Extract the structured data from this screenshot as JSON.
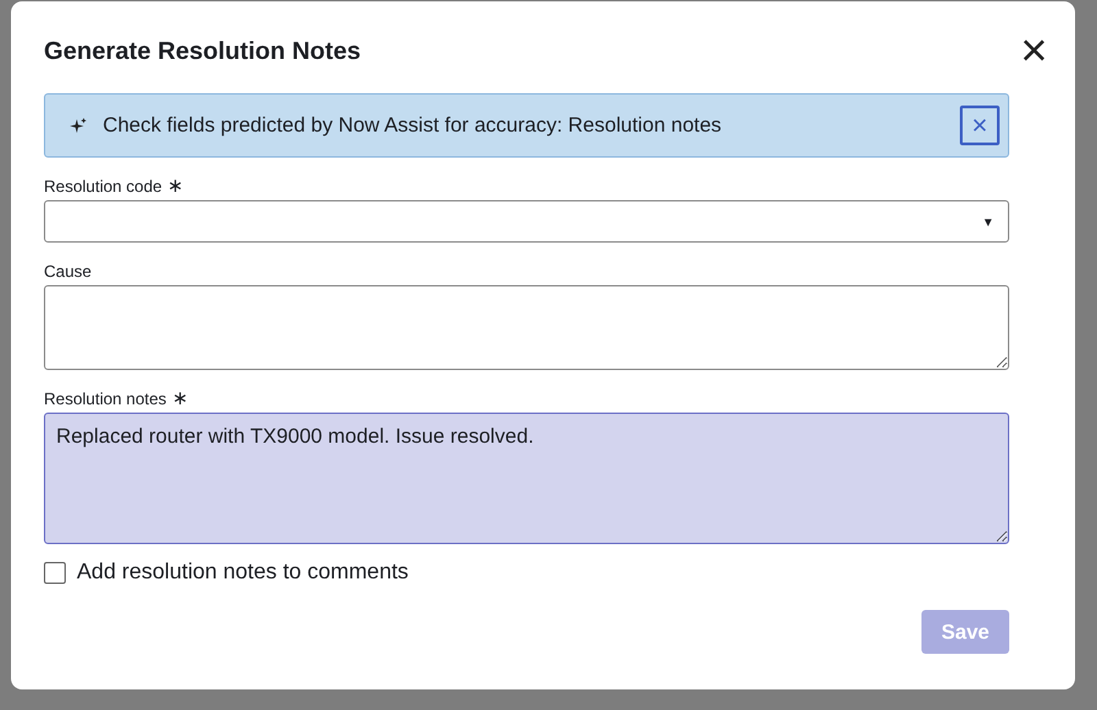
{
  "dialog": {
    "title": "Generate Resolution Notes",
    "close": "×"
  },
  "banner": {
    "message": "Check fields predicted by Now Assist for accuracy: Resolution notes",
    "dismiss": "×"
  },
  "fields": [
    {
      "kind": "select",
      "label": "Resolution code",
      "required_mark": "∗",
      "caret": "▼"
    },
    {
      "kind": "textarea",
      "label": "Cause",
      "predicted": false
    },
    {
      "kind": "textarea",
      "label": "Resolution notes",
      "required_mark": "∗",
      "value": "Replaced router with TX9000 model. Issue resolved.",
      "predicted": true
    }
  ],
  "checkbox": {
    "label": "Add resolution notes to comments",
    "checked": false
  },
  "save_button": {
    "label": "Save",
    "disabled": true
  }
}
